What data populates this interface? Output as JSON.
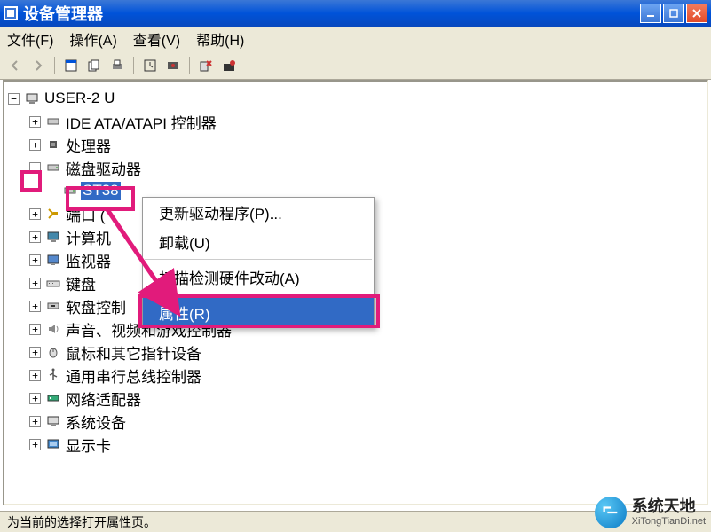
{
  "titlebar": {
    "title": "设备管理器"
  },
  "menubar": {
    "file": "文件(F)",
    "action": "操作(A)",
    "view": "查看(V)",
    "help": "帮助(H)"
  },
  "tree": {
    "root": "USER-2           U",
    "items": [
      {
        "label": "IDE ATA/ATAPI 控制器",
        "expanded": false
      },
      {
        "label": "处理器",
        "expanded": false
      },
      {
        "label": "磁盘驱动器",
        "expanded": true,
        "children": [
          {
            "label": "ST38",
            "selected": true
          }
        ]
      },
      {
        "label": "端口 (",
        "expanded": false
      },
      {
        "label": "计算机",
        "expanded": false
      },
      {
        "label": "监视器",
        "expanded": false
      },
      {
        "label": "键盘",
        "expanded": false
      },
      {
        "label": "软盘控制",
        "expanded": false
      },
      {
        "label": "声音、视频和游戏控制器",
        "expanded": false
      },
      {
        "label": "鼠标和其它指针设备",
        "expanded": false
      },
      {
        "label": "通用串行总线控制器",
        "expanded": false
      },
      {
        "label": "网络适配器",
        "expanded": false
      },
      {
        "label": "系统设备",
        "expanded": false
      },
      {
        "label": "显示卡",
        "expanded": false
      }
    ]
  },
  "context_menu": {
    "update_driver": "更新驱动程序(P)...",
    "uninstall": "卸载(U)",
    "scan_hardware": "扫描检测硬件改动(A)",
    "properties": "属性(R)"
  },
  "statusbar": {
    "text": "为当前的选择打开属性页。"
  },
  "watermark": {
    "main": "系统天地",
    "sub": "XiTongTianDi.net"
  },
  "colors": {
    "highlight": "#e11b7b",
    "selection": "#316ac5",
    "titlebar": "#0053d9"
  }
}
